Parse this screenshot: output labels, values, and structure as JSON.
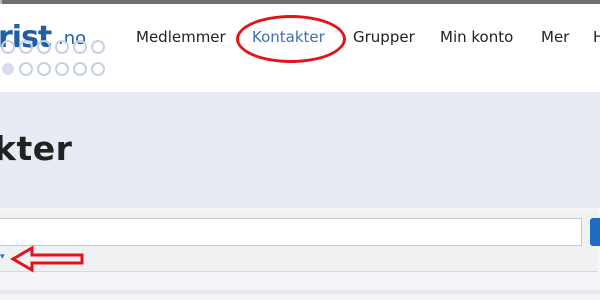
{
  "brand": {
    "logo_main": "rist",
    "logo_tld": ".no"
  },
  "nav": {
    "items": [
      {
        "label": "Medlemmer"
      },
      {
        "label": "Kontakter"
      },
      {
        "label": "Grupper"
      },
      {
        "label": "Min konto"
      },
      {
        "label": "Mer"
      },
      {
        "label": "H"
      }
    ],
    "active_index": 1
  },
  "page": {
    "title": "kter"
  },
  "search": {
    "value": "",
    "toggle_glyph": "▾"
  },
  "colors": {
    "brand": "#1f5fa5",
    "active_nav": "#3f6fb5",
    "annotation": "#e1141a",
    "banner_bg": "#e7ebf3",
    "button": "#1b6ec2"
  }
}
